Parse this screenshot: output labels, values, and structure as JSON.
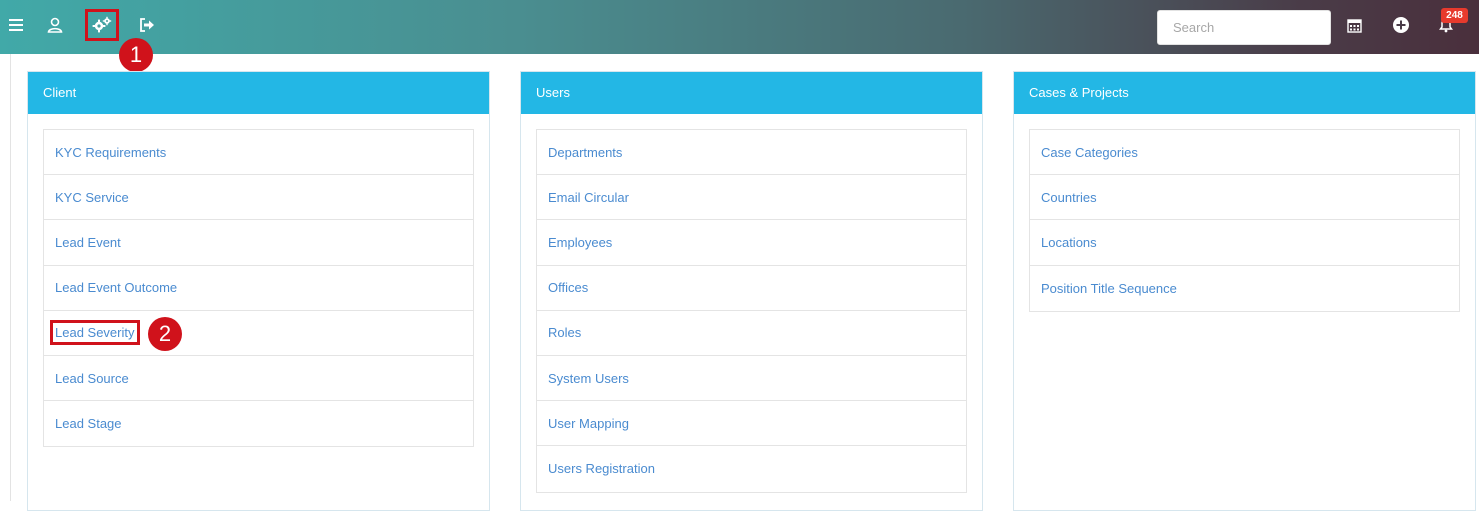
{
  "topbar": {
    "icons": [
      "menu-icon",
      "user-icon",
      "settings-gears-icon",
      "logout-icon",
      "calendar-icon",
      "add-circle-icon",
      "bell-icon"
    ],
    "search_placeholder": "Search",
    "notification_count": "248",
    "accent_colors": {
      "gradient_start": "#41a9a8",
      "gradient_end": "#4a2f3c",
      "highlight": "#d0121b"
    }
  },
  "markers": {
    "step1": "1",
    "step2": "2"
  },
  "panels": [
    {
      "title": "Client",
      "items": [
        "KYC Requirements",
        "KYC Service",
        "Lead Event",
        "Lead Event Outcome",
        "Lead Severity",
        "Lead Source",
        "Lead Stage"
      ]
    },
    {
      "title": "Users",
      "items": [
        "Departments",
        "Email Circular",
        "Employees",
        "Offices",
        "Roles",
        "System Users",
        "User Mapping",
        "Users Registration"
      ]
    },
    {
      "title": "Cases & Projects",
      "items": [
        "Case Categories",
        "Countries",
        "Locations",
        "Position Title Sequence"
      ]
    }
  ],
  "colors": {
    "panel_header": "#23b7e5",
    "link": "#4a8bd0"
  }
}
